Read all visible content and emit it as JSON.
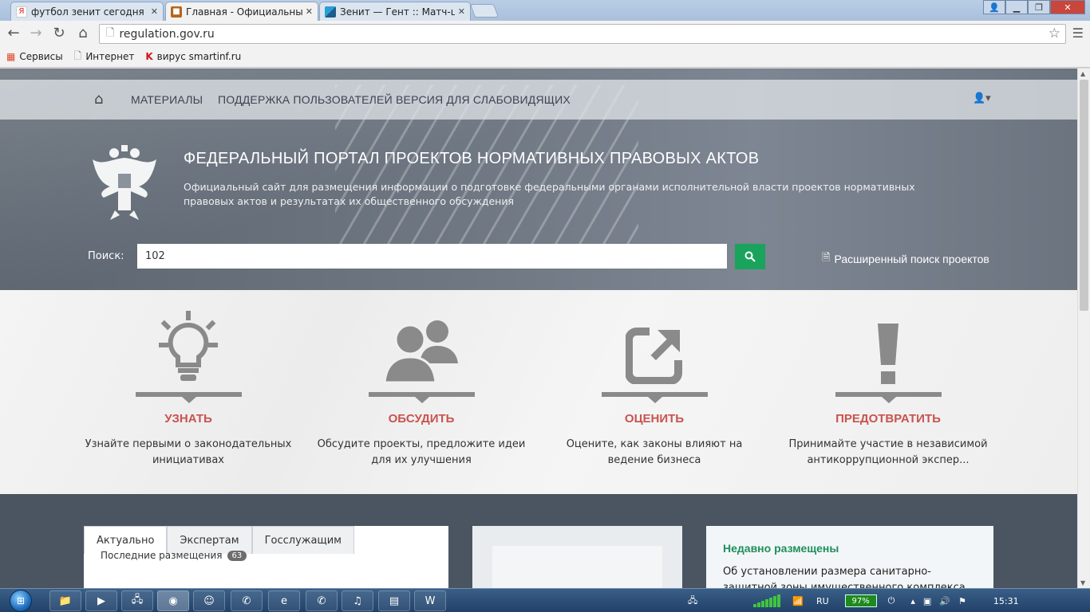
{
  "browser": {
    "tabs": [
      {
        "title": "футбол зенит сегодня пр",
        "favicon": "yandex-icon"
      },
      {
        "title": "Главная - Официальный",
        "favicon": "regulation-icon",
        "active": true
      },
      {
        "title": "Зенит — Гент :: Матч-цен",
        "favicon": "zenit-icon"
      }
    ],
    "close_glyph": "✕",
    "url": "regulation.gov.ru",
    "bookmarks": [
      {
        "label": "Сервисы",
        "icon": "apps-grid-icon"
      },
      {
        "label": "Интернет",
        "icon": "page-icon"
      },
      {
        "label": "вирус smartinf.ru",
        "icon": "kaspersky-icon"
      }
    ]
  },
  "site": {
    "nav": {
      "home_icon": "home-icon",
      "items": [
        "МАТЕРИАЛЫ",
        "ПОДДЕРЖКА ПОЛЬЗОВАТЕЛЕЙ",
        "ВЕРСИЯ ДЛЯ СЛАБОВИДЯЩИХ"
      ],
      "user_icon": "user-icon"
    },
    "hero": {
      "title": "ФЕДЕРАЛЬНЫЙ ПОРТАЛ ПРОЕКТОВ НОРМАТИВНЫХ ПРАВОВЫХ АКТОВ",
      "description": "Официальный сайт для размещения информации о подготовке федеральными органами исполнительной власти проектов нормативных правовых актов и результатах их общественного обсуждения"
    },
    "search": {
      "label": "Поиск:",
      "value": "102",
      "button_icon": "search-icon",
      "advanced_label": "Расширенный поиск проектов"
    },
    "features": [
      {
        "title": "УЗНАТЬ",
        "line1": "Узнайте первыми о законодательных",
        "line2": "инициативах",
        "icon": "lightbulb-icon"
      },
      {
        "title": "ОБСУДИТЬ",
        "line1": "Обсудите проекты, предложите идеи",
        "line2": "для их улучшения",
        "icon": "people-icon"
      },
      {
        "title": "ОЦЕНИТЬ",
        "line1": "Оцените, как законы влияют на",
        "line2": "ведение бизнеса",
        "icon": "external-link-icon"
      },
      {
        "title": "ПРЕДОТВРАТИТЬ",
        "line1": "Принимайте участие в независимой",
        "line2": "антикоррупционной экспер...",
        "icon": "exclamation-icon"
      }
    ],
    "lower": {
      "tabs": [
        "Актуально",
        "Экспертам",
        "Госслужащим"
      ],
      "latest_label": "Последние размещения",
      "latest_count": "63",
      "recent_heading": "Недавно размещены",
      "recent_text": "Об установлении размера санитарно-защитной зоны имущественного комплекса установки"
    }
  },
  "taskbar": {
    "language": "RU",
    "battery": "97%",
    "time": "15:31"
  }
}
